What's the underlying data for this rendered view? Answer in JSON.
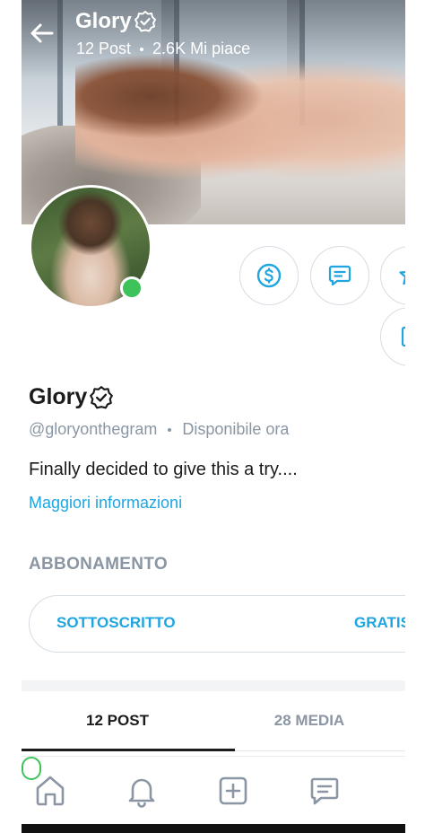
{
  "header": {
    "name": "Glory",
    "posts": "12 Post",
    "likes": "2.6K Mi piace"
  },
  "profile": {
    "name": "Glory",
    "handle": "@gloryonthegram",
    "status": "Disponibile ora",
    "bio": "Finally decided to give this a try....",
    "more_link": "Maggiori informazioni"
  },
  "subscription": {
    "section_title": "ABBONAMENTO",
    "subscribed_label": "SOTTOSCRITTO",
    "price_label": "GRATIS"
  },
  "tabs": [
    {
      "label": "12 POST",
      "active": true
    },
    {
      "label": "28 MEDIA",
      "active": false
    }
  ],
  "colors": {
    "accent": "#1fa5e0",
    "online": "#3ec35b",
    "muted": "#8a96a3",
    "text": "#1b1b1b",
    "border": "#d6dde3"
  },
  "icons": {
    "back": "arrow-left-icon",
    "verified": "verified-badge-icon",
    "tip": "dollar-circle-icon",
    "message": "message-icon",
    "favorite": "star-icon",
    "share": "share-icon",
    "home": "home-icon",
    "notifications": "bell-icon",
    "new_post": "plus-square-icon",
    "chats": "chat-icon"
  }
}
